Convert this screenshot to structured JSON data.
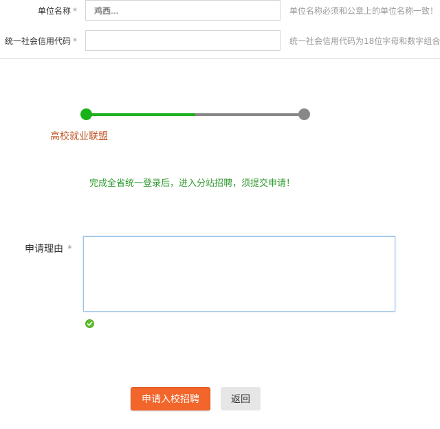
{
  "form": {
    "unit_name": {
      "label": "单位名称",
      "required_mark": "*",
      "value": "鸡西...",
      "hint": "单位名称必须和公章上的单位名称一致！"
    },
    "credit_code": {
      "label": "统一社会信用代码",
      "required_mark": "*",
      "value": "",
      "hint": "统一社会信用代码为18位字母和数字组合！"
    }
  },
  "progress": {
    "fraction": 0.5,
    "step_label": "高校就业联盟",
    "colors": {
      "done": "#1fb11f",
      "pending": "#888888"
    }
  },
  "notice": "完成全省统一登录后，进入分站招聘，须提交申请！",
  "reason": {
    "label": "申请理由",
    "required_mark": "*",
    "value": "",
    "valid_icon": "check-circle-icon"
  },
  "buttons": {
    "apply_label": "申请入校招聘",
    "back_label": "返回"
  },
  "colors": {
    "accent": "#f2652b",
    "success": "#2e9a2e",
    "step_label": "#c0582a"
  }
}
